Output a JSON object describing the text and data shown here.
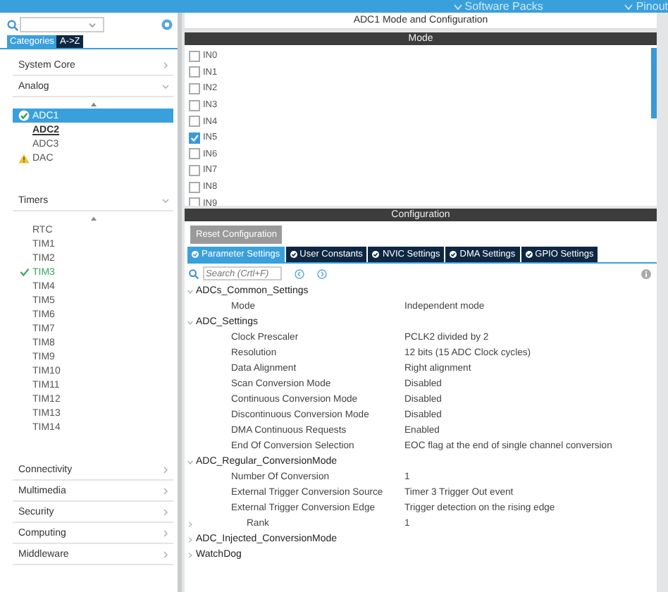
{
  "top_bar": {
    "menus": [
      {
        "label": "Software Packs"
      },
      {
        "label": "Pinout"
      }
    ]
  },
  "sidebar": {
    "tabs": [
      {
        "label": "Categories",
        "selected": true
      },
      {
        "label": "A->Z",
        "selected": false
      }
    ],
    "categories": [
      {
        "label": "System Core",
        "expanded": false
      },
      {
        "label": "Analog",
        "expanded": true,
        "items": [
          {
            "label": "ADC1",
            "selected": true,
            "ok": true,
            "warning": false,
            "hovered": false
          },
          {
            "label": "ADC2",
            "selected": false,
            "ok": false,
            "warning": false,
            "hovered": true
          },
          {
            "label": "ADC3",
            "selected": false,
            "ok": false,
            "warning": false,
            "hovered": false
          },
          {
            "label": "DAC",
            "selected": false,
            "ok": false,
            "warning": true,
            "hovered": false
          }
        ]
      },
      {
        "label": "Timers",
        "expanded": true,
        "items": [
          {
            "label": "RTC",
            "selected": false,
            "ok": false,
            "warning": false,
            "hovered": false
          },
          {
            "label": "TIM1",
            "selected": false,
            "ok": false,
            "warning": false,
            "hovered": false
          },
          {
            "label": "TIM2",
            "selected": false,
            "ok": false,
            "warning": false,
            "hovered": false
          },
          {
            "label": "TIM3",
            "selected": false,
            "ok": true,
            "warning": false,
            "hovered": false
          },
          {
            "label": "TIM4",
            "selected": false,
            "ok": false,
            "warning": false,
            "hovered": false
          },
          {
            "label": "TIM5",
            "selected": false,
            "ok": false,
            "warning": false,
            "hovered": false
          },
          {
            "label": "TIM6",
            "selected": false,
            "ok": false,
            "warning": false,
            "hovered": false
          },
          {
            "label": "TIM7",
            "selected": false,
            "ok": false,
            "warning": false,
            "hovered": false
          },
          {
            "label": "TIM8",
            "selected": false,
            "ok": false,
            "warning": false,
            "hovered": false
          },
          {
            "label": "TIM9",
            "selected": false,
            "ok": false,
            "warning": false,
            "hovered": false
          },
          {
            "label": "TIM10",
            "selected": false,
            "ok": false,
            "warning": false,
            "hovered": false
          },
          {
            "label": "TIM11",
            "selected": false,
            "ok": false,
            "warning": false,
            "hovered": false
          },
          {
            "label": "TIM12",
            "selected": false,
            "ok": false,
            "warning": false,
            "hovered": false
          },
          {
            "label": "TIM13",
            "selected": false,
            "ok": false,
            "warning": false,
            "hovered": false
          },
          {
            "label": "TIM14",
            "selected": false,
            "ok": false,
            "warning": false,
            "hovered": false
          }
        ]
      },
      {
        "label": "Connectivity",
        "expanded": false
      },
      {
        "label": "Multimedia",
        "expanded": false
      },
      {
        "label": "Security",
        "expanded": false
      },
      {
        "label": "Computing",
        "expanded": false
      },
      {
        "label": "Middleware",
        "expanded": false
      }
    ]
  },
  "panel": {
    "title": "ADC1 Mode and Configuration",
    "mode_header": "Mode",
    "channels": [
      {
        "label": "IN0",
        "checked": false
      },
      {
        "label": "IN1",
        "checked": false
      },
      {
        "label": "IN2",
        "checked": false
      },
      {
        "label": "IN3",
        "checked": false
      },
      {
        "label": "IN4",
        "checked": false
      },
      {
        "label": "IN5",
        "checked": true
      },
      {
        "label": "IN6",
        "checked": false
      },
      {
        "label": "IN7",
        "checked": false
      },
      {
        "label": "IN8",
        "checked": false
      },
      {
        "label": "IN9",
        "checked": false
      }
    ],
    "config_header": "Configuration",
    "reset_button": "Reset Configuration",
    "tabs": [
      {
        "label": "Parameter Settings",
        "selected": true
      },
      {
        "label": "User Constants",
        "selected": false
      },
      {
        "label": "NVIC Settings",
        "selected": false
      },
      {
        "label": "DMA Settings",
        "selected": false
      },
      {
        "label": "GPIO Settings",
        "selected": false
      }
    ],
    "search": {
      "placeholder": "Search (Crtl+F)"
    },
    "tree": [
      {
        "label": "ADCs_Common_Settings",
        "expanded": true,
        "children": [
          {
            "label": "Mode",
            "value": "Independent mode"
          }
        ]
      },
      {
        "label": "ADC_Settings",
        "expanded": true,
        "children": [
          {
            "label": "Clock Prescaler",
            "value": "PCLK2 divided by 2"
          },
          {
            "label": "Resolution",
            "value": "12 bits (15 ADC Clock cycles)"
          },
          {
            "label": "Data Alignment",
            "value": "Right alignment"
          },
          {
            "label": "Scan Conversion Mode",
            "value": "Disabled"
          },
          {
            "label": "Continuous Conversion Mode",
            "value": "Disabled"
          },
          {
            "label": "Discontinuous Conversion Mode",
            "value": "Disabled"
          },
          {
            "label": "DMA Continuous Requests",
            "value": "Enabled"
          },
          {
            "label": "End Of Conversion Selection",
            "value": "EOC flag at the end of single channel conversion"
          }
        ]
      },
      {
        "label": "ADC_Regular_ConversionMode",
        "expanded": true,
        "children": [
          {
            "label": "Number Of Conversion",
            "value": "1"
          },
          {
            "label": "External Trigger Conversion Source",
            "value": "Timer 3 Trigger Out event"
          },
          {
            "label": "External Trigger Conversion Edge",
            "value": "Trigger detection on the rising edge"
          },
          {
            "label": "Rank",
            "value": "1",
            "expanded": false
          }
        ]
      },
      {
        "label": "ADC_Injected_ConversionMode",
        "expanded": false
      },
      {
        "label": "WatchDog",
        "expanded": false
      }
    ]
  }
}
